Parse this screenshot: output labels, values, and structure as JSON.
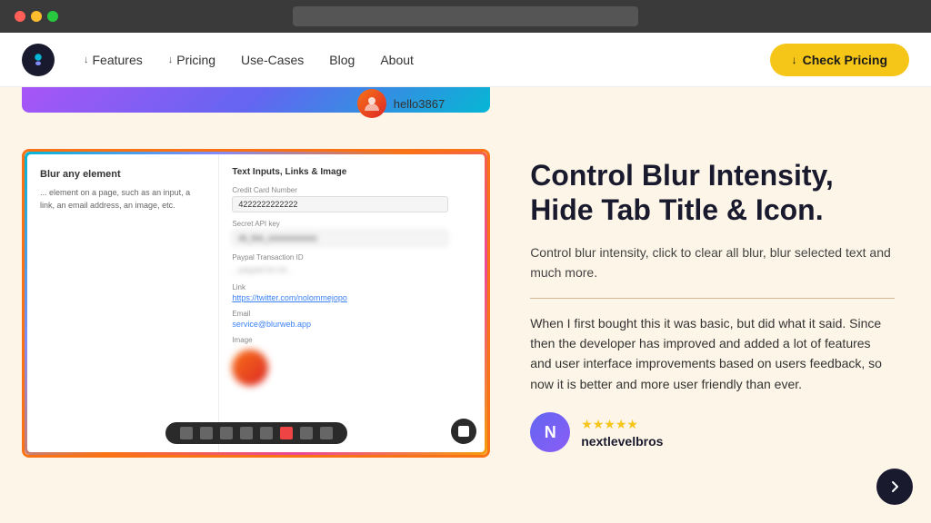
{
  "browser": {
    "traffic_lights": [
      "red",
      "yellow",
      "green"
    ]
  },
  "navbar": {
    "logo_label": "Logo",
    "links": [
      {
        "label": "Features",
        "has_arrow": true,
        "id": "features"
      },
      {
        "label": "Pricing",
        "has_arrow": true,
        "id": "pricing"
      },
      {
        "label": "Use-Cases",
        "has_arrow": false,
        "id": "use-cases"
      },
      {
        "label": "Blog",
        "has_arrow": false,
        "id": "blog"
      },
      {
        "label": "About",
        "has_arrow": false,
        "id": "about"
      }
    ],
    "cta_label": "Check Pricing",
    "cta_arrow": "↓"
  },
  "profile_snippet": {
    "username": "hello3867"
  },
  "demo": {
    "left_title": "Blur any element",
    "left_text": "... element on a page, such as an input, a link, an email address, an image, etc.",
    "right_title": "Text Inputs, Links & Image",
    "fields": [
      {
        "label": "Credit Card Number",
        "value": "4222222222222",
        "blurred": false
      },
      {
        "label": "Secret API key",
        "value": "••••••••••••",
        "blurred": true
      },
      {
        "label": "Paypal Transaction ID",
        "value": "...",
        "blurred": true
      },
      {
        "label": "Link",
        "value": "https://twitter.com/nolommejopo",
        "is_link": true
      },
      {
        "label": "Email",
        "value": "service@blurweb.app",
        "is_link": true
      },
      {
        "label": "Image",
        "value": "",
        "is_image": true
      }
    ]
  },
  "feature": {
    "title": "Control Blur Intensity,\nHide Tab Title & Icon.",
    "description": "Control blur intensity, click to clear all blur, blur selected text and much more.",
    "testimonial": "When I first bought this it was basic, but did what it said. Since then the developer has improved and added a lot of features and user interface improvements based on users feedback, so now it is better and more user friendly than ever.",
    "author_name": "nextlevelbros",
    "stars": "★★★★★",
    "author_initial": "N"
  }
}
